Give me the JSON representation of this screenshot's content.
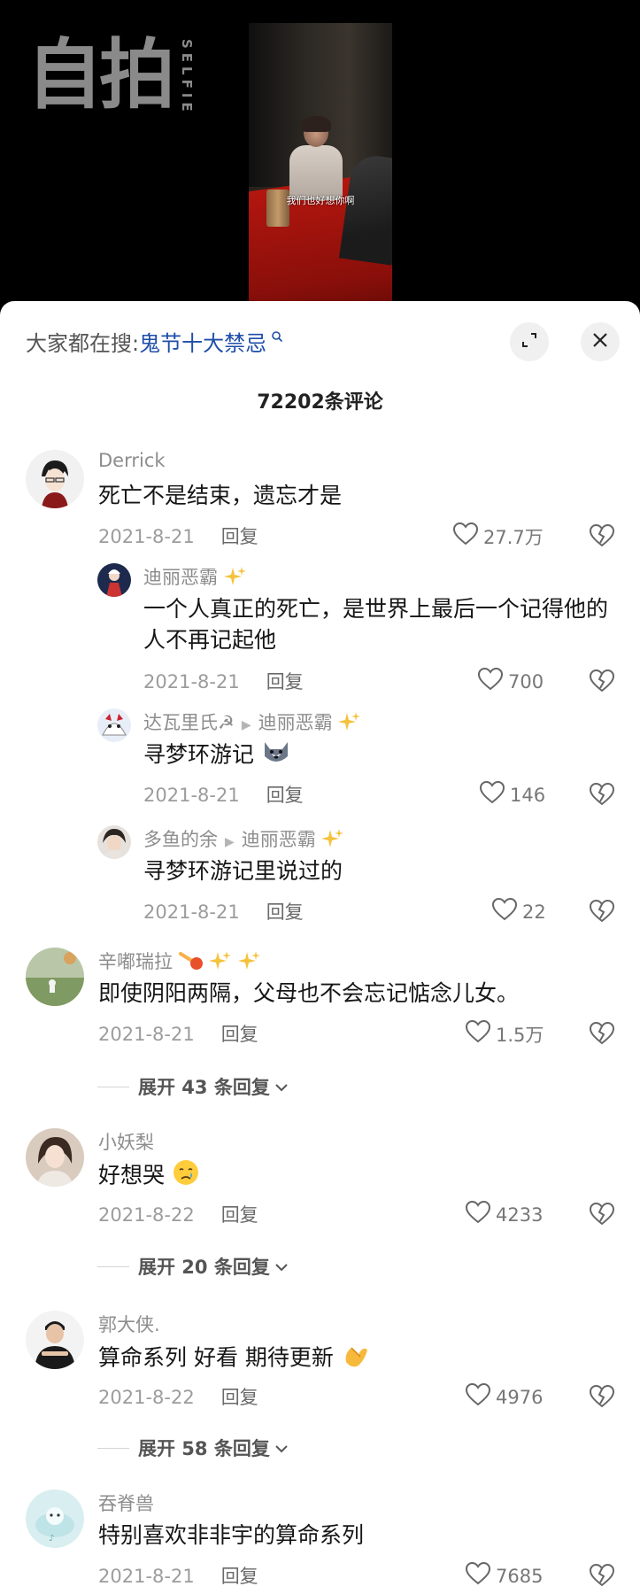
{
  "video": {
    "logo_text": "自拍",
    "logo_sub": "SELFIE",
    "subtitle": "我们也好想你啊"
  },
  "sheet": {
    "search_prefix": "大家都在搜:",
    "search_keyword": "鬼节十大禁忌",
    "comment_count": "72202条评论"
  },
  "comments": [
    {
      "user": "Derrick",
      "text": "死亡不是结束，遗忘才是",
      "date": "2021-8-21",
      "reply_label": "回复",
      "likes": "27.7万"
    },
    {
      "user": "迪丽恶霸",
      "text": "一个人真正的死亡，是世界上最后一个记得他的人不再记起他",
      "date": "2021-8-21",
      "reply_label": "回复",
      "likes": "700"
    },
    {
      "user": "达瓦里氏☭",
      "reply_to": "迪丽恶霸",
      "text": "寻梦环游记",
      "date": "2021-8-21",
      "reply_label": "回复",
      "likes": "146"
    },
    {
      "user": "多鱼的余",
      "reply_to": "迪丽恶霸",
      "text": "寻梦环游记里说过的",
      "date": "2021-8-21",
      "reply_label": "回复",
      "likes": "22"
    },
    {
      "user": "辛嘟瑞拉",
      "text": "即使阴阳两隔，父母也不会忘记惦念儿女。",
      "date": "2021-8-21",
      "reply_label": "回复",
      "likes": "1.5万"
    },
    {
      "user": "小妖梨",
      "text": "好想哭",
      "date": "2021-8-22",
      "reply_label": "回复",
      "likes": "4233"
    },
    {
      "user": "郭大侠.",
      "text": "算命系列 好看 期待更新",
      "date": "2021-8-22",
      "reply_label": "回复",
      "likes": "4976"
    },
    {
      "user": "吞脊兽",
      "text": "特别喜欢非非宇的算命系列",
      "date": "2021-8-21",
      "reply_label": "回复",
      "likes": "7685"
    }
  ],
  "expanders": [
    {
      "label": "展开 43 条回复"
    },
    {
      "label": "展开 20 条回复"
    },
    {
      "label": "展开 58 条回复"
    }
  ],
  "colors": {
    "keyword": "#1e4ea8",
    "sheet_bg": "#ffffff",
    "meta": "#9c9c9c"
  },
  "icons": [
    "search-icon",
    "expand-icon",
    "close-icon",
    "heart-icon",
    "broken-heart-icon",
    "chevron-down-icon",
    "sparkle-icon"
  ]
}
